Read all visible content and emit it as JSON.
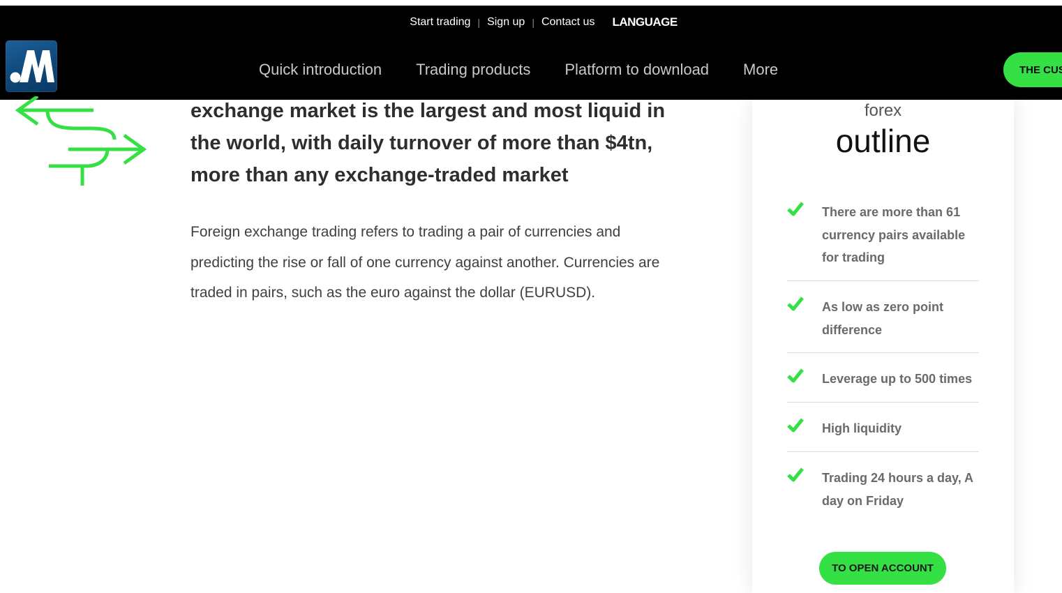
{
  "colors": {
    "accent": "#35e045",
    "nav_bg": "#000000",
    "logo_bg": "#0e4878"
  },
  "topbar": {
    "links": [
      "Start trading",
      "Sign up",
      "Contact us"
    ],
    "separator": "|",
    "language": "LANGUAGE"
  },
  "nav": {
    "items": [
      "Quick introduction",
      "Trading products",
      "Platform to download",
      "More"
    ],
    "cta": "THE CUS"
  },
  "main": {
    "icon": "exchange-arrows-icon",
    "headline": "exchange market is the largest and most liquid in the world, with daily turnover of more than $4tn, more than any exchange-traded market",
    "body": "Foreign exchange trading refers to trading a pair of currencies and predicting the rise or fall of one currency against another. Currencies are traded in pairs, such as the euro against the dollar (EURUSD)."
  },
  "card": {
    "subtitle": "forex",
    "title": "outline",
    "features": [
      "There are more than 61 currency pairs available for trading",
      "As low as zero point difference",
      "Leverage up to 500 times",
      "High liquidity",
      "Trading 24 hours a day, A day on Friday"
    ],
    "button": "TO OPEN ACCOUNT"
  }
}
